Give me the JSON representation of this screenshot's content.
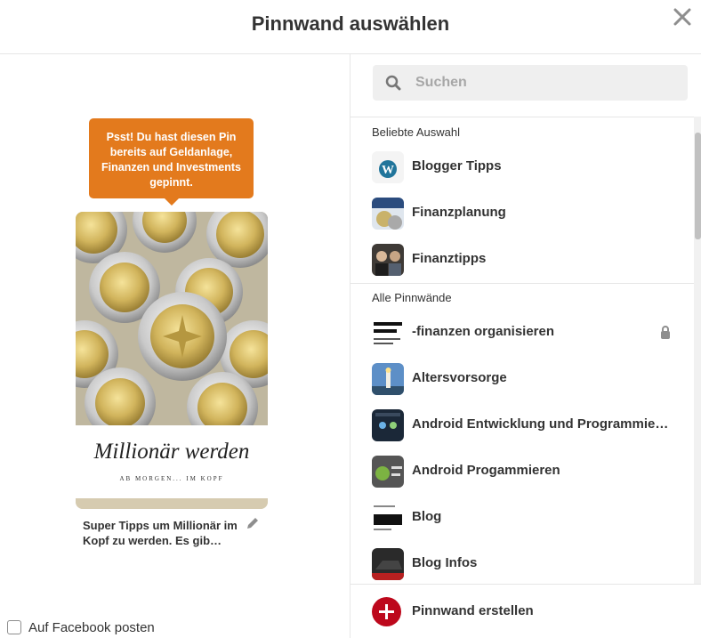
{
  "dialog": {
    "title": "Pinnwand auswählen"
  },
  "pin": {
    "notice": "Psst! Du hast diesen Pin bereits auf Geldanlage, Finanzen und Investments gepinnt.",
    "image_title": "Millionär werden",
    "image_subtitle": "AB MORGEN... IM KOPF",
    "description": "Super Tipps um Millionär im Kopf zu werden. Es gib…"
  },
  "facebook": {
    "label": "Auf Facebook posten",
    "checked": false
  },
  "search": {
    "placeholder": "Suchen",
    "value": ""
  },
  "sections": {
    "popular_label": "Beliebte Auswahl",
    "all_label": "Alle Pinnwände"
  },
  "popular_boards": [
    {
      "name": "Blogger Tipps",
      "thumb": "wordpress-logo"
    },
    {
      "name": "Finanzplanung",
      "thumb": "geldsorgen-image"
    },
    {
      "name": "Finanztipps",
      "thumb": "people-image"
    }
  ],
  "all_boards": [
    {
      "name": "-finanzen organisieren",
      "thumb": "dauernd-pleite-image",
      "secret": true
    },
    {
      "name": "Altersvorsorge",
      "thumb": "lighthouse-image",
      "secret": false
    },
    {
      "name": "Android Entwicklung und Programmie…",
      "thumb": "dark-dashboard-image",
      "secret": false
    },
    {
      "name": "Android Progammieren",
      "thumb": "android-studio-image",
      "secret": false
    },
    {
      "name": "Blog",
      "thumb": "blog-text-image",
      "secret": false
    },
    {
      "name": "Blog Infos",
      "thumb": "car-image",
      "secret": false
    }
  ],
  "create": {
    "label": "Pinnwand erstellen"
  },
  "colors": {
    "tooltip": "#e37a1d",
    "create_button": "#bd081c",
    "search_bg": "#efefef"
  }
}
